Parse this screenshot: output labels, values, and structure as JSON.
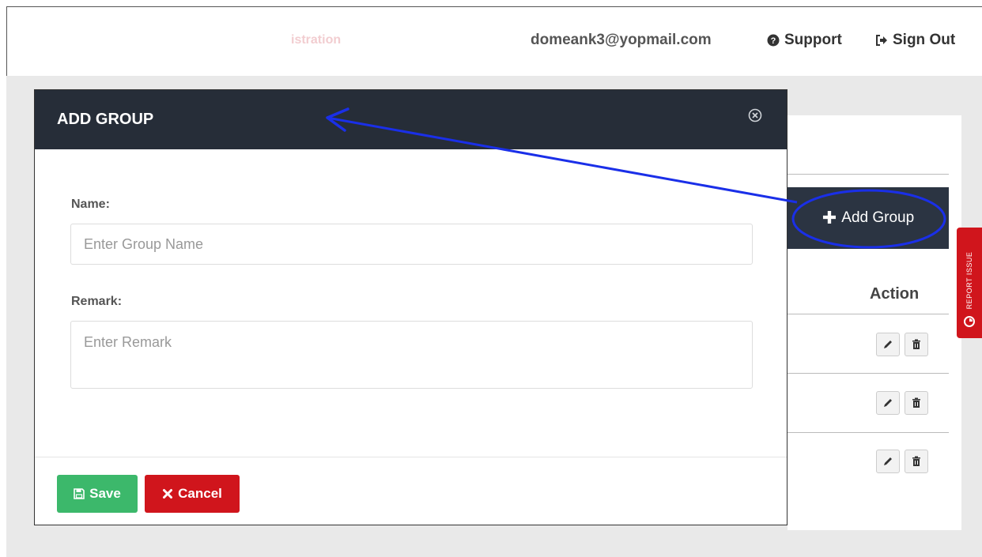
{
  "header": {
    "faded_title": "istration",
    "user_email": "domeank3@yopmail.com",
    "support_label": "Support",
    "signout_label": "Sign Out"
  },
  "background": {
    "add_group_label": "Add Group",
    "action_header": "Action",
    "report_tab_label": "REPORT ISSUE"
  },
  "modal": {
    "title": "ADD GROUP",
    "name_label": "Name:",
    "name_placeholder": "Enter Group Name",
    "name_value": "",
    "remark_label": "Remark:",
    "remark_placeholder": "Enter Remark",
    "remark_value": "",
    "save_label": "Save",
    "cancel_label": "Cancel"
  },
  "colors": {
    "modal_header": "#262d38",
    "save": "#3cb86b",
    "cancel": "#d0151c",
    "annotation": "#1a2fe8"
  },
  "icons": [
    "question-circle-icon",
    "sign-out-icon",
    "close-circle-icon",
    "plus-icon",
    "pencil-icon",
    "trash-icon",
    "floppy-disk-icon",
    "x-icon",
    "report-issue-icon"
  ]
}
